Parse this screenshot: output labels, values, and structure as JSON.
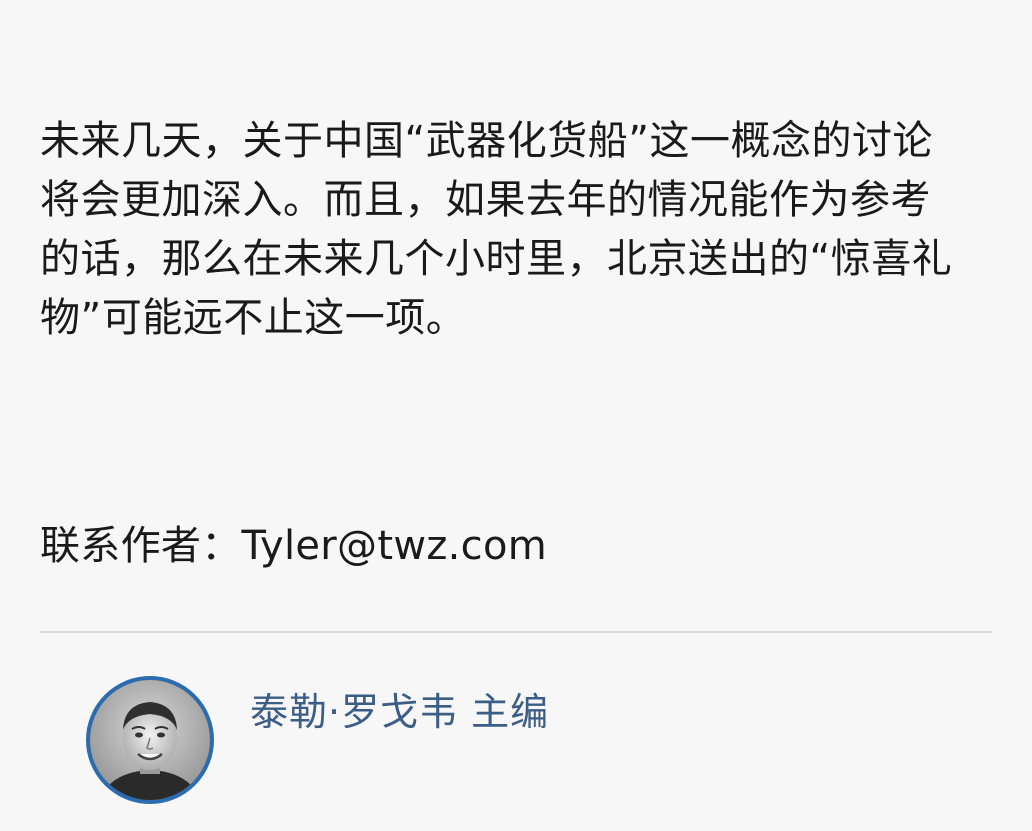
{
  "article": {
    "paragraph": "未来几天，关于中国“武器化货船”这一概念的讨论将会更加深入。而且，如果去年的情况能作为参考的话，那么在未来几个小时里，北京送出的“惊喜礼物”可能远不止这一项。",
    "contact": "联系作者：Tyler@twz.com"
  },
  "author": {
    "name": "泰勒·罗戈韦 主编",
    "avatar_icon": "author-photo"
  },
  "colors": {
    "background": "#f7f7f7",
    "text": "#1a1a1a",
    "author_link": "#3b5d86",
    "avatar_border": "#2b6cb0",
    "divider": "#dcdcdc"
  }
}
